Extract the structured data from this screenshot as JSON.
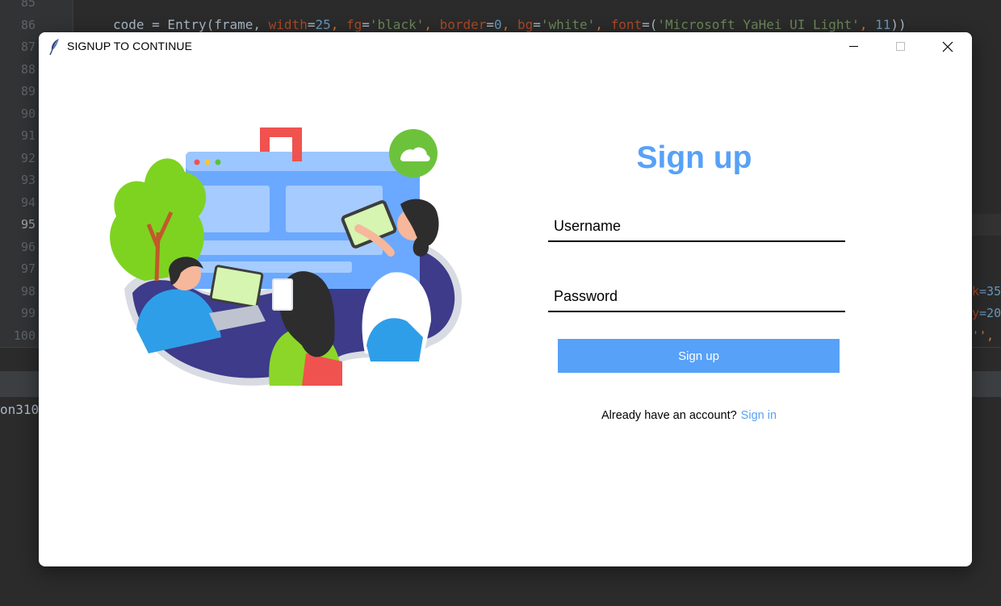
{
  "ide": {
    "line_numbers": [
      "85",
      "86",
      "87",
      "88",
      "89",
      "90",
      "91",
      "92",
      "93",
      "94",
      "95",
      "96",
      "97",
      "98",
      "99",
      "100"
    ],
    "active_line": "95",
    "code_line_86": {
      "p1": "code = Entry(frame, ",
      "width_kw": "width",
      "eq1": "=",
      "width_val": "25",
      "sep1": ", ",
      "fg_kw": "fg",
      "eq2": "=",
      "fg_val": "'black'",
      "sep2": ", ",
      "border_kw": "border",
      "eq3": "=",
      "border_val": "0",
      "sep3": ", ",
      "bg_kw": "bg",
      "eq4": "=",
      "bg_val": "'white'",
      "sep4": ", ",
      "font_kw": "font",
      "eq5": "=(",
      "font_val": "'Microsoft YaHei UI Light'",
      "sep5": ", ",
      "size_val": "11",
      "close": "))"
    },
    "console_text": "on310",
    "peek_98": "=35",
    "peek_99": "=20",
    "peek_100": "',"
  },
  "window": {
    "title": "SIGNUP TO CONTINUE",
    "minimize_glyph": "—",
    "maximize_glyph": "☐",
    "close_glyph": "✕"
  },
  "form": {
    "heading": "Sign up",
    "username_placeholder": "Username",
    "password_placeholder": "Password",
    "submit_label": "Sign up",
    "have_account_text": "Already have an account?",
    "signin_link": "Sign in"
  },
  "colors": {
    "accent": "#57a1f8",
    "ide_background": "#2b2b2b"
  },
  "icons": [
    "feather-icon",
    "minimize-icon",
    "maximize-icon",
    "close-icon"
  ]
}
